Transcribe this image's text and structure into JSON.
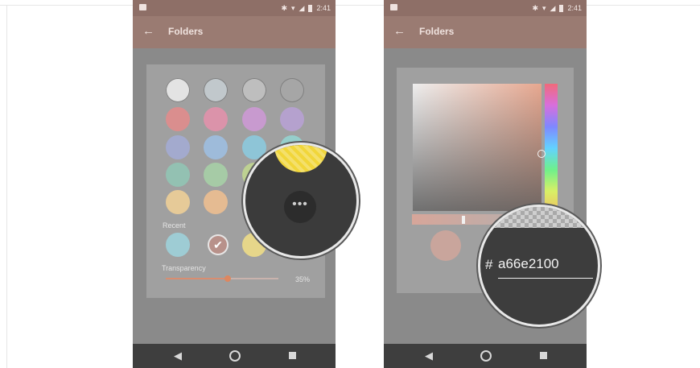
{
  "status": {
    "time": "2:41",
    "icons": [
      "bluetooth-icon",
      "wifi-icon",
      "signal-icon",
      "battery-icon"
    ]
  },
  "left_screen": {
    "appbar_title": "Folders",
    "recent_label": "Recent",
    "transparency_label": "Transparency",
    "transparency_value": "35%",
    "transparency_level": 0.55,
    "swatches": [
      [
        "#efefef",
        "#c7cfd4",
        "#c4c4c4",
        "#a8a8a8"
      ],
      [
        "#e48b8b",
        "#e590ab",
        "#cf99d7",
        "#b8a1d6"
      ],
      [
        "#a3acd6",
        "#9dbfe4",
        "#8bcbe0",
        "#94d6d2"
      ],
      [
        "#91c7b5",
        "#a7d2a7",
        "#c3d98f",
        ""
      ],
      [
        "#f2d196",
        "#f1bf8f",
        "",
        ""
      ]
    ],
    "recent_swatches": [
      "#9dd4dd",
      "#b8918a",
      "#f2df86"
    ],
    "magnifier": {
      "more_label": "•••",
      "preview_color": "#f1d63a"
    }
  },
  "right_screen": {
    "appbar_title": "Folders",
    "hex_prefix": "#",
    "hex_value": "a66e2100",
    "preview_color": "#c9a59c"
  },
  "accent": "#9a7b72"
}
